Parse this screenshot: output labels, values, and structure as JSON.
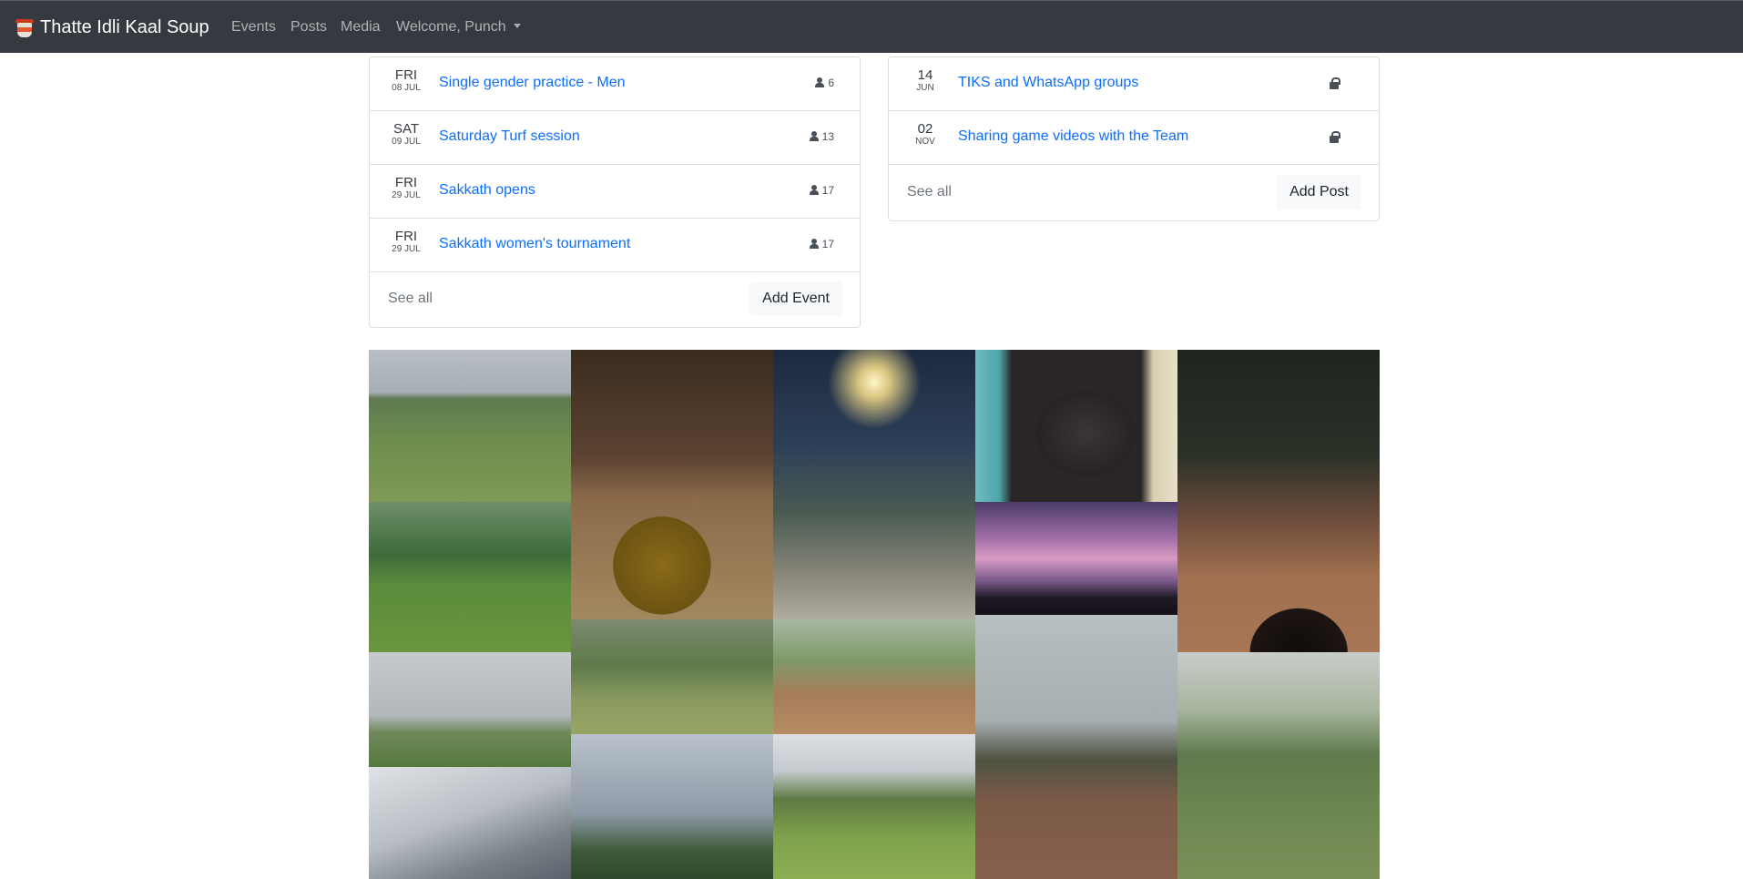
{
  "navbar": {
    "brand": "Thatte Idli Kaal Soup",
    "links": [
      "Events",
      "Posts",
      "Media"
    ],
    "user_menu": "Welcome, Punch"
  },
  "events": {
    "items": [
      {
        "day": "FRI",
        "date": "08 JUL",
        "title": "Single gender practice - Men",
        "count": "6"
      },
      {
        "day": "SAT",
        "date": "09 JUL",
        "title": "Saturday Turf session",
        "count": "13"
      },
      {
        "day": "FRI",
        "date": "29 JUL",
        "title": "Sakkath opens",
        "count": "17"
      },
      {
        "day": "FRI",
        "date": "29 JUL",
        "title": "Sakkath women's tournament",
        "count": "17"
      }
    ],
    "see_all": "See all",
    "add_button": "Add Event"
  },
  "posts": {
    "items": [
      {
        "day": "14",
        "month": "JUN",
        "title": "TIKS and WhatsApp groups"
      },
      {
        "day": "02",
        "month": "NOV",
        "title": "Sharing game videos with the Team"
      }
    ],
    "see_all": "See all",
    "add_button": "Add Post"
  },
  "colors": {
    "navbar": "#343a40",
    "link": "#0d6efd",
    "muted": "#6c757d"
  }
}
